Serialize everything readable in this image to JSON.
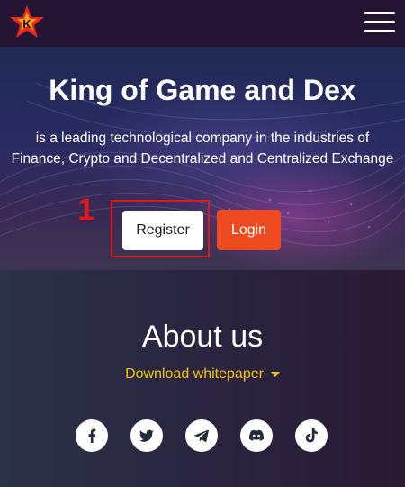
{
  "header": {
    "logo_icon": "star-k-logo",
    "menu_icon": "hamburger-menu-icon"
  },
  "hero": {
    "title": "King of Game and Dex",
    "description_line1": "is a leading technological company in the industries of",
    "description_line2": "Finance, Crypto and Decentralized and Centralized Exchange",
    "register_label": "Register",
    "login_label": "Login",
    "annotation_number": "1"
  },
  "about": {
    "title": "About us",
    "whitepaper_label": "Download whitepaper"
  },
  "social": [
    "facebook-icon",
    "twitter-icon",
    "telegram-icon",
    "discord-icon",
    "tiktok-icon"
  ],
  "colors": {
    "login_button": "#ee4a1f",
    "whitepaper_link": "#f5c412",
    "annotation_red": "#e01818",
    "header_bg": "#241433"
  }
}
